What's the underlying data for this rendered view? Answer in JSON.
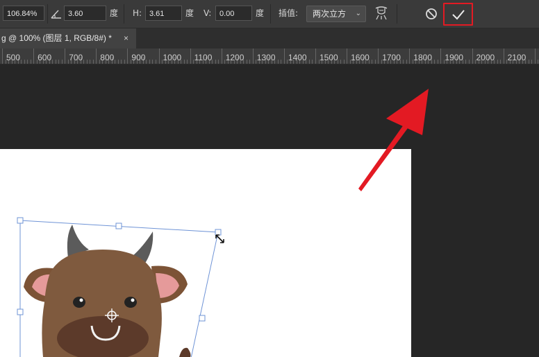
{
  "options_bar": {
    "zoom_value": "106.84%",
    "angle_value": "3.60",
    "angle_unit": "度",
    "h_label": "H:",
    "h_value": "3.61",
    "h_unit": "度",
    "v_label": "V:",
    "v_value": "0.00",
    "v_unit": "度",
    "interp_label": "插值:",
    "interp_value": "两次立方",
    "icons": {
      "angle": "angle-icon",
      "warp": "warp-mode-icon",
      "cancel": "cancel-transform-icon",
      "commit": "commit-transform-icon"
    }
  },
  "document_tab": {
    "title": "g @ 100% (图层 1, RGB/8#) *",
    "close": "×"
  },
  "ruler": {
    "labels": [
      "500",
      "600",
      "700",
      "800",
      "900",
      "1000",
      "1100",
      "1200",
      "1300",
      "1400",
      "1500",
      "1600",
      "1700",
      "1800",
      "1900",
      "2000",
      "2100"
    ]
  },
  "colors": {
    "highlight": "#e31a23",
    "arrow": "#e31a23",
    "transform_box": "#6e93d6",
    "canvas": "#ffffff",
    "workspace": "#262626"
  }
}
